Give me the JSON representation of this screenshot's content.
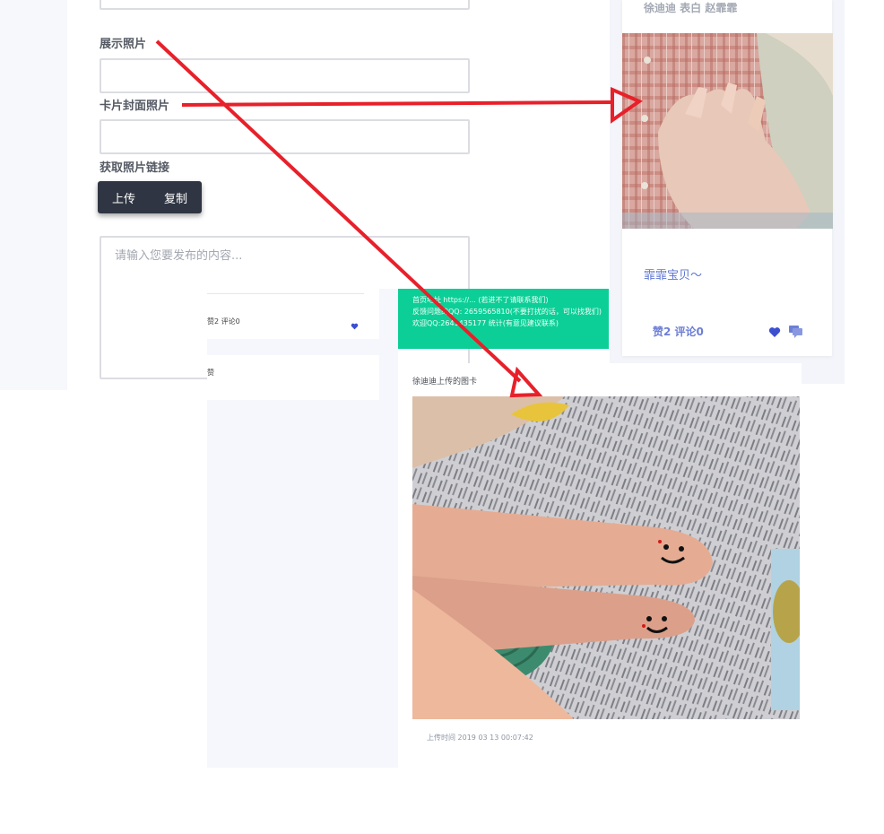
{
  "form": {
    "label_display_photo": "展示照片",
    "label_cover_photo": "卡片封面照片",
    "label_get_link": "获取照片链接",
    "btn_upload": "上传",
    "btn_copy": "复制",
    "content_placeholder": "请输入您要发布的内容..."
  },
  "preview_card": {
    "names": "徐迪迪 表白 赵霏霏",
    "caption": "霏霏宝贝～",
    "likes_comments": "赞2   评论0"
  },
  "middle": {
    "tiny_likes": "赞2  评论0",
    "tiny_row2": "赞",
    "green_lines": [
      "首页地址 https://... (若进不了请联系我们)",
      "反馈问题的QQ: 2659565810(不要打扰的话，可以找我们)",
      "欢迎QQ:2641435177 统计(有意见建议联系)"
    ],
    "photo_card_title": "徐迪迪上传的图卡",
    "upload_time": "上传时间 2019 03 13 00:07:42"
  },
  "colors": {
    "arrow": "#e8202a",
    "green": "#0ccf97",
    "accent": "#5d76d2",
    "dark_btn": "#2f3542"
  }
}
